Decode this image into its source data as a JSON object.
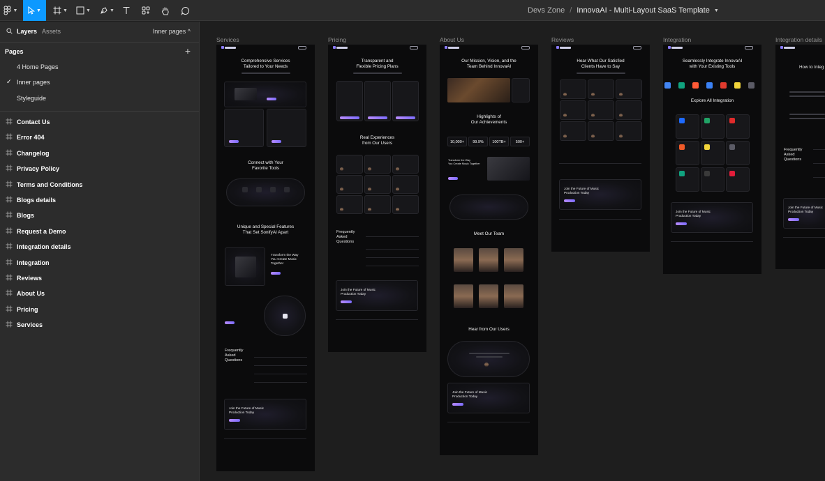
{
  "toolbar": {
    "file_team": "Devs Zone",
    "file_separator": "/",
    "file_name": "InnovaAI - Multi-Layout SaaS Template",
    "active_tool": "move",
    "tools": [
      "main-menu-icon",
      "move-icon",
      "frame-icon",
      "shape-icon",
      "pen-icon",
      "text-icon",
      "components-icon",
      "hand-icon",
      "comment-icon"
    ],
    "active_color": "#0d99ff"
  },
  "sidebar": {
    "tab_layers": "Layers",
    "tab_assets": "Assets",
    "current_page_switch": "Inner pages ^",
    "pages_heading": "Pages",
    "add_page_glyph": "+",
    "check_glyph": "✓",
    "pages": [
      {
        "label": "4 Home Pages",
        "selected": false
      },
      {
        "label": "Inner pages",
        "selected": true
      },
      {
        "label": "Styleguide",
        "selected": false
      }
    ],
    "frames": [
      "Contact Us",
      "Error 404",
      "Changelog",
      "Privacy Policy",
      "Terms and Conditions",
      "Blogs details",
      "Blogs",
      "Request a Demo",
      "Integration details",
      "Integration",
      "Reviews",
      "About Us",
      "Pricing",
      "Services"
    ]
  },
  "canvas": {
    "background": "#1e1e1e",
    "frames": [
      {
        "label": "Services"
      },
      {
        "label": "Pricing"
      },
      {
        "label": "About Us"
      },
      {
        "label": "Reviews"
      },
      {
        "label": "Integration"
      },
      {
        "label": "Integration details"
      }
    ],
    "services": {
      "hero": "Comprehensive Services\nTailored to Your Needs",
      "connect": "Connect with Your\nFavorite Tools",
      "features": "Unique and Special Features\nThat Set SonifyAI Apart",
      "transform": "Transform the Way\nYou Create Music Together",
      "faq": "Frequently\nAsked\nQuestions",
      "cta": "Join the Future of Music\nProduction Today"
    },
    "pricing": {
      "hero": "Transparent and\nFlexible Pricing Plans",
      "testimonials": "Real Experiences\nfrom Our Users",
      "faq": "Frequently\nAsked\nQuestions",
      "cta": "Join the Future of Music\nProduction Today"
    },
    "about": {
      "hero": "Our Mission, Vision, and the\nTeam Behind InnovaAI",
      "highlights": "Highlights of\nOur Achievements",
      "stats": [
        "10,000+",
        "99.9%",
        "100TB+",
        "500+"
      ],
      "transform": "Transform the Way\nYou Create Music Together",
      "team": "Meet Our Team",
      "hear": "Hear from Our Users",
      "cta": "Join the Future of Music\nProduction Today"
    },
    "reviews": {
      "hero": "Hear What Our Satisfied\nClients Have to Say",
      "cta": "Join the Future of Music\nProduction Today"
    },
    "integration": {
      "hero": "Seamlessly Integrate InnovaAI\nwith Your Existing Tools",
      "explore": "Explore All Integration",
      "cta": "Join the Future of Music\nProduction Today"
    },
    "integration_details": {
      "hero": "How to Integ",
      "faq": "Frequently\nAsked\nQuestions",
      "cta": "Join the Future of Music\nProduction Today"
    }
  }
}
